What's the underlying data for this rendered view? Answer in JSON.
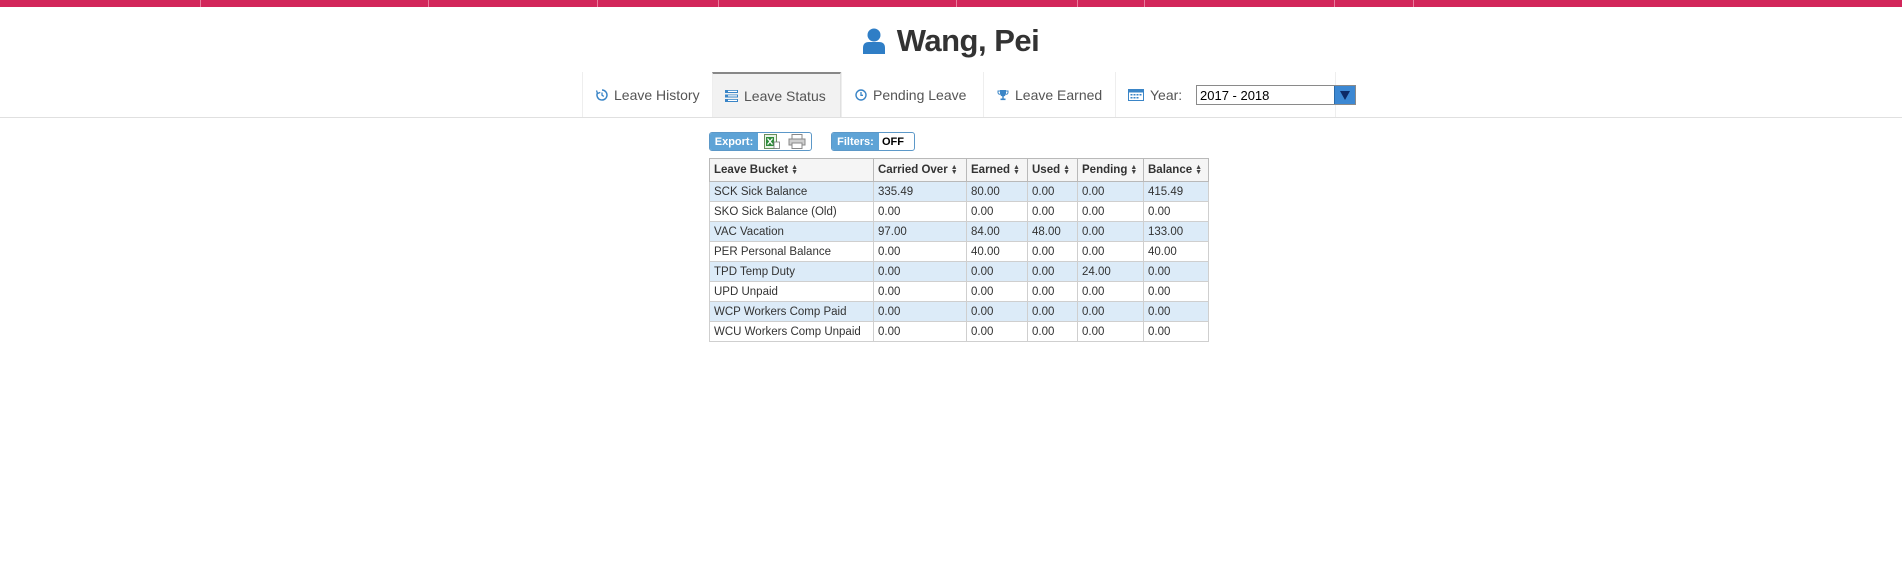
{
  "header": {
    "user_name": "Wang, Pei"
  },
  "nav": {
    "items": [
      {
        "label": "Leave History",
        "icon": "history-icon"
      },
      {
        "label": "Leave Status",
        "icon": "list-icon",
        "active": true
      },
      {
        "label": "Pending Leave",
        "icon": "clock-icon"
      },
      {
        "label": "Leave Earned",
        "icon": "trophy-icon"
      }
    ],
    "year_label": "Year:",
    "year_value": "2017 - 2018"
  },
  "toolbar": {
    "export_label": "Export:",
    "filters_label": "Filters:",
    "filters_value": "OFF"
  },
  "table": {
    "columns": [
      "Leave Bucket",
      "Carried Over",
      "Earned",
      "Used",
      "Pending",
      "Balance"
    ],
    "rows": [
      [
        "SCK Sick Balance",
        "335.49",
        "80.00",
        "0.00",
        "0.00",
        "415.49"
      ],
      [
        "SKO Sick Balance (Old)",
        "0.00",
        "0.00",
        "0.00",
        "0.00",
        "0.00"
      ],
      [
        "VAC Vacation",
        "97.00",
        "84.00",
        "48.00",
        "0.00",
        "133.00"
      ],
      [
        "PER Personal Balance",
        "0.00",
        "40.00",
        "0.00",
        "0.00",
        "40.00"
      ],
      [
        "TPD Temp Duty",
        "0.00",
        "0.00",
        "0.00",
        "24.00",
        "0.00"
      ],
      [
        "UPD Unpaid",
        "0.00",
        "0.00",
        "0.00",
        "0.00",
        "0.00"
      ],
      [
        "WCP Workers Comp Paid",
        "0.00",
        "0.00",
        "0.00",
        "0.00",
        "0.00"
      ],
      [
        "WCU Workers Comp Unpaid",
        "0.00",
        "0.00",
        "0.00",
        "0.00",
        "0.00"
      ]
    ]
  },
  "colors": {
    "topbar": "#d2265a",
    "accent": "#3a85c7",
    "row_alt": "#dcebf8"
  }
}
